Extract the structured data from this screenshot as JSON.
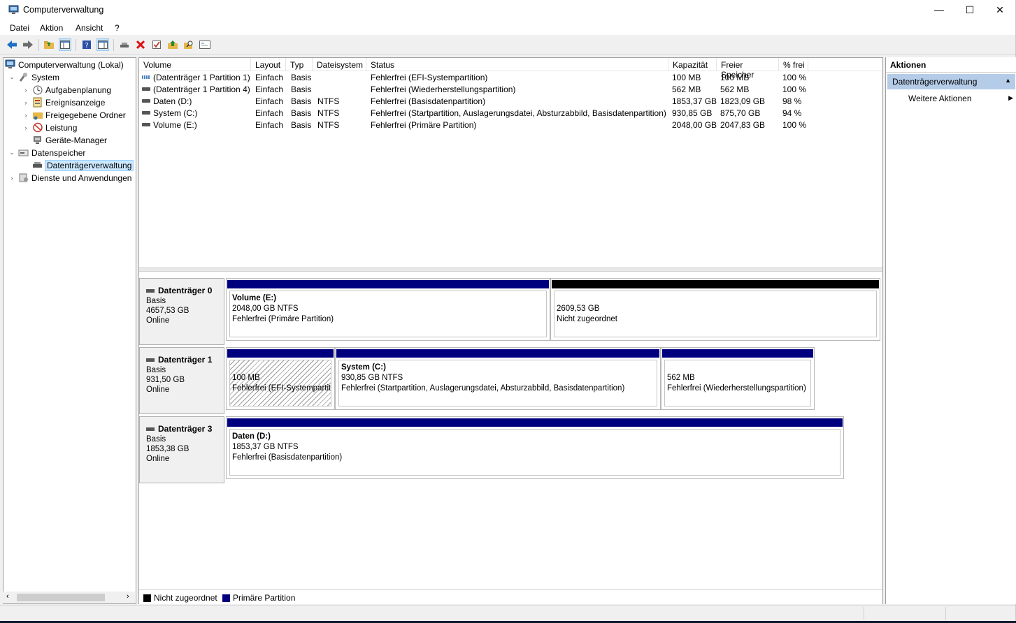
{
  "window": {
    "title": "Computerverwaltung"
  },
  "menu": [
    "Datei",
    "Aktion",
    "Ansicht",
    "?"
  ],
  "tree": {
    "root": "Computerverwaltung (Lokal)",
    "system": "System",
    "aufgaben": "Aufgabenplanung",
    "ereignis": "Ereignisanzeige",
    "freigabe": "Freigegebene Ordner",
    "leistung": "Leistung",
    "geraete": "Geräte-Manager",
    "datenspeicher": "Datenspeicher",
    "dtv": "Datenträgerverwaltung",
    "dienste": "Dienste und Anwendungen"
  },
  "columns": [
    "Volume",
    "Layout",
    "Typ",
    "Dateisystem",
    "Status",
    "Kapazität",
    "Freier Speicher",
    "% frei"
  ],
  "volumes": [
    [
      "(Datenträger 1 Partition 1)",
      "Einfach",
      "Basis",
      "",
      "Fehlerfrei (EFI-Systempartition)",
      "100 MB",
      "100 MB",
      "100 %"
    ],
    [
      "(Datenträger 1 Partition 4)",
      "Einfach",
      "Basis",
      "",
      "Fehlerfrei (Wiederherstellungspartition)",
      "562 MB",
      "562 MB",
      "100 %"
    ],
    [
      "Daten (D:)",
      "Einfach",
      "Basis",
      "NTFS",
      "Fehlerfrei (Basisdatenpartition)",
      "1853,37 GB",
      "1823,09 GB",
      "98 %"
    ],
    [
      "System (C:)",
      "Einfach",
      "Basis",
      "NTFS",
      "Fehlerfrei (Startpartition, Auslagerungsdatei, Absturzabbild, Basisdatenpartition)",
      "930,85 GB",
      "875,70 GB",
      "94 %"
    ],
    [
      "Volume (E:)",
      "Einfach",
      "Basis",
      "NTFS",
      "Fehlerfrei (Primäre Partition)",
      "2048,00 GB",
      "2047,83 GB",
      "100 %"
    ]
  ],
  "disks": [
    {
      "name": "Datenträger 0",
      "type": "Basis",
      "size": "4657,53 GB",
      "state": "Online",
      "parts": [
        {
          "title": "Volume  (E:)",
          "line1": "2048,00 GB NTFS",
          "line2": "Fehlerfrei (Primäre Partition)",
          "bar": "#00007f"
        },
        {
          "title": "",
          "line1": "2609,53 GB",
          "line2": "Nicht zugeordnet",
          "bar": "#000000"
        }
      ]
    },
    {
      "name": "Datenträger 1",
      "type": "Basis",
      "size": "931,50 GB",
      "state": "Online",
      "parts": [
        {
          "title": "",
          "line1": "100 MB",
          "line2": "Fehlerfrei (EFI-Systempartition)",
          "bar": "#00007f"
        },
        {
          "title": "System  (C:)",
          "line1": "930,85 GB NTFS",
          "line2": "Fehlerfrei (Startpartition, Auslagerungsdatei, Absturzabbild, Basisdatenpartition)",
          "bar": "#00007f"
        },
        {
          "title": "",
          "line1": "562 MB",
          "line2": "Fehlerfrei (Wiederherstellungspartition)",
          "bar": "#00007f"
        }
      ]
    },
    {
      "name": "Datenträger 3",
      "type": "Basis",
      "size": "1853,38 GB",
      "state": "Online",
      "parts": [
        {
          "title": "Daten  (D:)",
          "line1": "1853,37 GB NTFS",
          "line2": "Fehlerfrei (Basisdatenpartition)",
          "bar": "#00007f"
        }
      ]
    }
  ],
  "legend": {
    "unallocated": "Nicht zugeordnet",
    "primary": "Primäre Partition",
    "unallocated_color": "#000000",
    "primary_color": "#00007f"
  },
  "actions": {
    "header": "Aktionen",
    "section": "Datenträgerverwaltung",
    "more": "Weitere Aktionen"
  },
  "icons": [
    "computer-management-icon",
    "back-icon",
    "forward-icon",
    "up-folder-icon",
    "show-tree-icon",
    "help-icon",
    "properties-icon",
    "connect-icon",
    "delete-icon",
    "checkbox-icon",
    "export-icon",
    "search-icon",
    "console-icon",
    "disk-icon"
  ]
}
